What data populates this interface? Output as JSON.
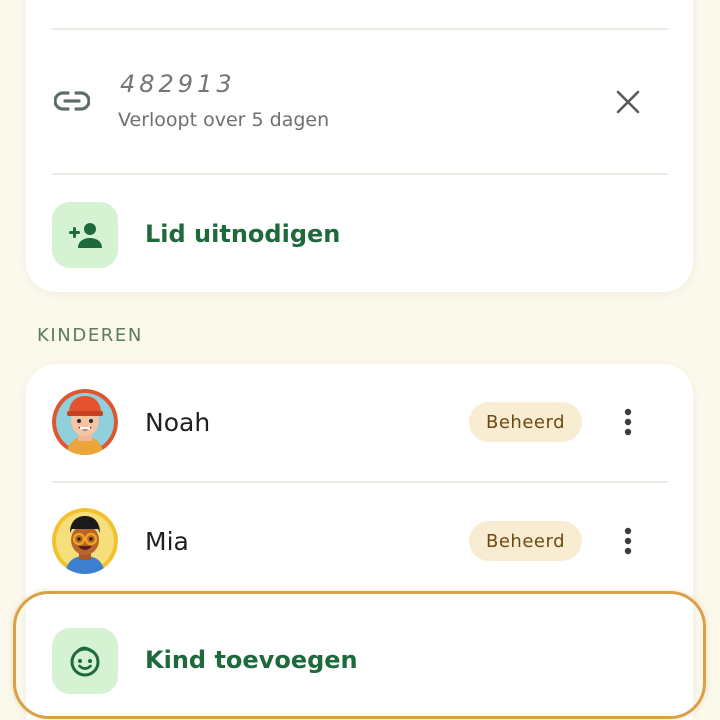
{
  "invite": {
    "code": "482913",
    "expiry": "Verloopt over 5 dagen",
    "add_member_label": "Lid uitnodigen"
  },
  "kids_section": {
    "title": "KINDEREN",
    "children": [
      {
        "name": "Noah",
        "badge": "Beheerd"
      },
      {
        "name": "Mia",
        "badge": "Beheerd"
      }
    ],
    "add_child_label": "Kind toevoegen"
  },
  "colors": {
    "accent_green": "#1e6a3c",
    "tile_green": "#d5f2d3",
    "badge_bg": "#f8ecd3",
    "highlight_ring": "#d9a04a",
    "background": "#fbf8ec"
  }
}
